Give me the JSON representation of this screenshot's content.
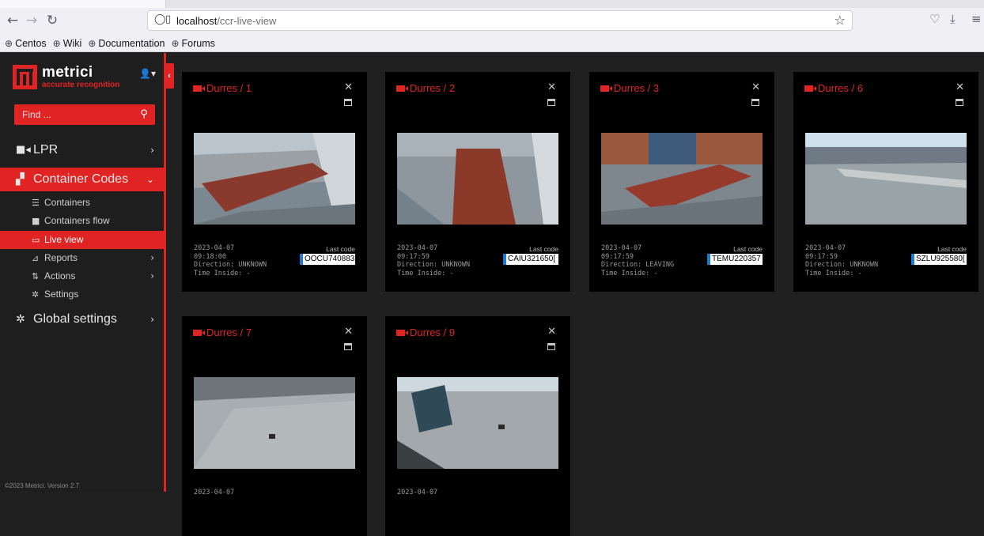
{
  "browser": {
    "back_icon": "arrow-left-icon",
    "url_host": "localhost",
    "url_path": "/ccr-live-view",
    "bookmarks": [
      "Centos",
      "Wiki",
      "Documentation",
      "Forums"
    ]
  },
  "sidebar": {
    "brand_name": "metrici",
    "brand_tagline": "accurate recognition",
    "search_placeholder": "Find ...",
    "menu": {
      "lpr": "LPR",
      "container_codes": "Container Codes",
      "containers": "Containers",
      "containers_flow": "Containers flow",
      "live_view": "Live view",
      "reports": "Reports",
      "actions": "Actions",
      "settings": "Settings",
      "global_settings": "Global settings"
    },
    "footer": "©2023 Metrici. Version 2.7"
  },
  "cameras": [
    {
      "title": "Durres / 1",
      "date": "2023-04-07",
      "time": "09:18:00",
      "direction": "Direction: UNKNOWN",
      "inside": "Time Inside: -",
      "last_code_label": "Last code",
      "code": "OOCU740883"
    },
    {
      "title": "Durres / 2",
      "date": "2023-04-07",
      "time": "09:17:59",
      "direction": "Direction: UNKNOWN",
      "inside": "Time Inside: -",
      "last_code_label": "Last code",
      "code": "CAIU321650["
    },
    {
      "title": "Durres / 3",
      "date": "2023-04-07",
      "time": "09:17:59",
      "direction": "Direction: LEAVING",
      "inside": "Time Inside: -",
      "last_code_label": "Last code",
      "code": "TEMU220357"
    },
    {
      "title": "Durres / 6",
      "date": "2023-04-07",
      "time": "09:17:59",
      "direction": "Direction: UNKNOWN",
      "inside": "Time Inside: -",
      "last_code_label": "Last code",
      "code": "SZLU925580["
    },
    {
      "title": "Durres / 7",
      "date": "2023-04-07"
    },
    {
      "title": "Durres / 9",
      "date": "2023-04-07"
    }
  ],
  "colors": {
    "accent": "#e02424",
    "code_marker": "#1e78d6"
  }
}
